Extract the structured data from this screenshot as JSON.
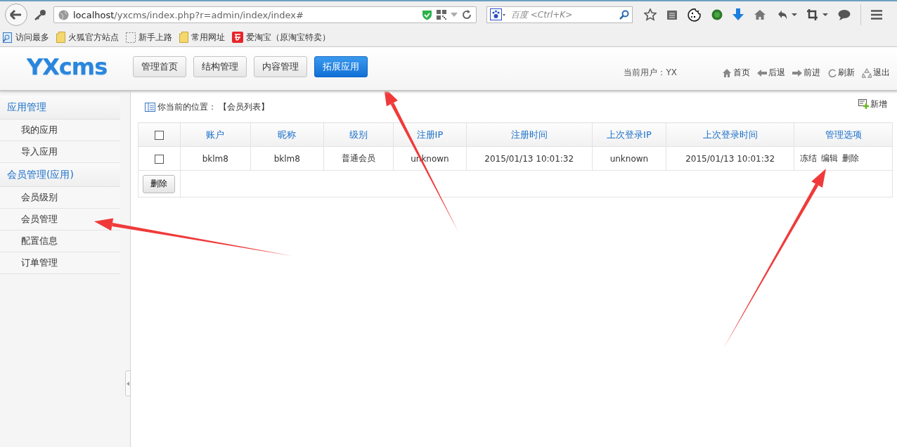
{
  "browser": {
    "url_host": "localhost",
    "url_path": "/yxcms/index.php?r=admin/index/index#",
    "search_placeholder": "百度 <Ctrl+K>",
    "bookmarks": [
      {
        "label": "访问最多",
        "kind": "search"
      },
      {
        "label": "火狐官方站点",
        "kind": "folder"
      },
      {
        "label": "新手上路",
        "kind": "dashed"
      },
      {
        "label": "常用网址",
        "kind": "folder"
      },
      {
        "label": "爱淘宝（原淘宝特卖）",
        "kind": "taobao"
      }
    ]
  },
  "header": {
    "logo": "YXcms",
    "nav": [
      {
        "label": "管理首页",
        "selected": false
      },
      {
        "label": "结构管理",
        "selected": false
      },
      {
        "label": "内容管理",
        "selected": false
      },
      {
        "label": "拓展应用",
        "selected": true
      }
    ],
    "current_user": "当前用户：YX",
    "links": [
      {
        "label": "首页",
        "kind": "home"
      },
      {
        "label": "后退",
        "kind": "back"
      },
      {
        "label": "前进",
        "kind": "forward"
      },
      {
        "label": "刷新",
        "kind": "refresh"
      },
      {
        "label": "退出",
        "kind": "logout"
      }
    ]
  },
  "sidebar": {
    "groups": [
      {
        "title": "应用管理",
        "items": [
          {
            "label": "我的应用"
          },
          {
            "label": "导入应用"
          }
        ]
      },
      {
        "title": "会员管理(应用)",
        "items": [
          {
            "label": "会员级别"
          },
          {
            "label": "会员管理"
          },
          {
            "label": "配置信息"
          },
          {
            "label": "订单管理"
          }
        ]
      }
    ]
  },
  "content": {
    "breadcrumb_label": "你当前的位置：",
    "breadcrumb_location": "【会员列表】",
    "add_link": "新增",
    "table": {
      "select_all": {
        "checked": false
      },
      "columns": [
        "账户",
        "昵称",
        "级别",
        "注册IP",
        "注册时间",
        "上次登录IP",
        "上次登录时间",
        "管理选项"
      ],
      "rows": [
        {
          "checked": false,
          "cells": [
            "bklm8",
            "bklm8",
            "普通会员",
            "unknown",
            "2015/01/13 10:01:32",
            "unknown",
            "2015/01/13 10:01:32"
          ],
          "actions": [
            "冻结",
            "编辑",
            "删除"
          ]
        }
      ],
      "delete_button": "删除"
    }
  }
}
